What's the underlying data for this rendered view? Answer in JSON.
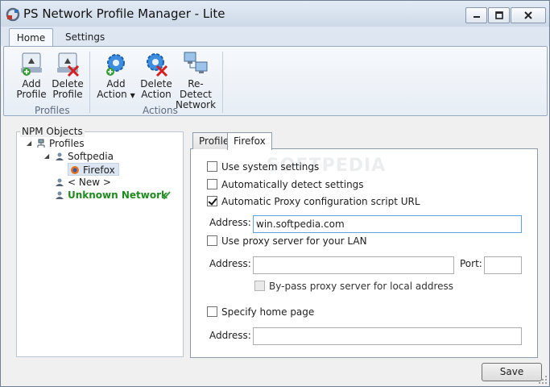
{
  "window": {
    "title": "PS Network Profile Manager - Lite",
    "icons": {
      "app": "network-wrench-icon",
      "minimize": "minimize-icon",
      "maximize": "maximize-icon",
      "close": "close-icon"
    }
  },
  "ribbon": {
    "tabs": [
      {
        "label": "Home",
        "active": true
      },
      {
        "label": "Settings",
        "active": false
      }
    ],
    "groups": [
      {
        "label": "Profiles",
        "buttons": [
          {
            "line1": "Add",
            "line2": "Profile",
            "icon": "add-profile-icon"
          },
          {
            "line1": "Delete",
            "line2": "Profile",
            "icon": "delete-profile-icon"
          }
        ]
      },
      {
        "label": "Actions",
        "buttons": [
          {
            "line1": "Add",
            "line2": "Action",
            "has_dropdown": true,
            "icon": "gear-add-icon"
          },
          {
            "line1": "Delete",
            "line2": "Action",
            "icon": "gear-delete-icon"
          },
          {
            "line1": "Re-Detect",
            "line2": "Network",
            "icon": "computer-network-icon"
          }
        ]
      }
    ]
  },
  "tree": {
    "legend": "NPM Objects",
    "nodes": {
      "profiles": "Profiles",
      "softpedia": "Softpedia",
      "firefox": "Firefox",
      "new": "< New >",
      "unknown": "Unknown Network"
    },
    "colors": {
      "unknown": "#1f8a1f",
      "selection": "#dce6f3"
    }
  },
  "tabs": [
    {
      "label": "Profile",
      "active": false
    },
    {
      "label": "Firefox",
      "active": true
    }
  ],
  "watermark": "SOFTPEDIA",
  "form": {
    "use_system_settings": {
      "label": "Use system settings",
      "checked": false
    },
    "auto_detect": {
      "label": "Automatically detect settings",
      "checked": false
    },
    "auto_proxy_script": {
      "label": "Automatic Proxy configuration script URL",
      "checked": true
    },
    "script_address": {
      "label": "Address:",
      "value": "win.softpedia.com"
    },
    "use_proxy_lan": {
      "label": "Use proxy server for your LAN",
      "checked": false
    },
    "proxy_address": {
      "label": "Address:",
      "value": ""
    },
    "proxy_port": {
      "label": "Port:",
      "value": ""
    },
    "bypass_local": {
      "label": "By-pass proxy server for local address",
      "checked": false,
      "disabled": true
    },
    "home_page": {
      "label": "Specify home page",
      "checked": false
    },
    "home_address": {
      "label": "Address:",
      "value": ""
    }
  },
  "footer": {
    "save_label": "Save"
  }
}
